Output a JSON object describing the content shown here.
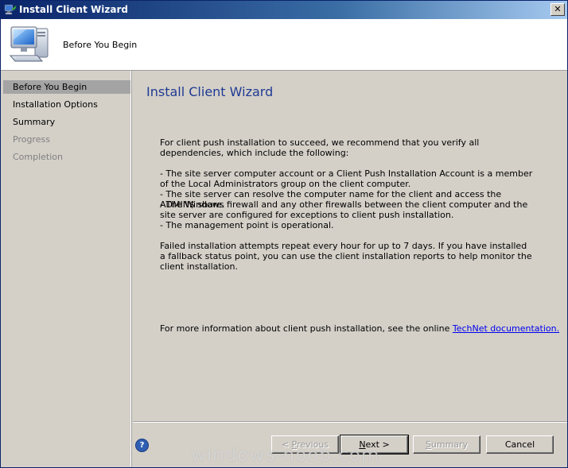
{
  "window": {
    "title": "Install Client Wizard",
    "close_glyph": "✕"
  },
  "header": {
    "title": "Before You Begin",
    "icon": "computer-icon"
  },
  "nav": {
    "items": [
      {
        "label": "Before You Begin",
        "state": "active"
      },
      {
        "label": "Installation Options",
        "state": "normal"
      },
      {
        "label": "Summary",
        "state": "normal"
      },
      {
        "label": "Progress",
        "state": "disabled"
      },
      {
        "label": "Completion",
        "state": "disabled"
      }
    ]
  },
  "content": {
    "heading": "Install Client Wizard",
    "paragraphs": [
      "For client push installation to succeed, we recommend that you verify all dependencies, which include the following:",
      "- The site server computer account or a Client Push Installation Account is a member of the Local Administrators group on the client computer.",
      "- The site server can resolve the computer name for the client and access the ADMIN$ share.",
      "- The Windows firewall and any other firewalls between the client computer and the site server are configured for exceptions to client push installation.",
      "- The management point is operational.",
      "Failed installation attempts repeat every hour for up to 7 days. If you have installed a fallback status point, you can use the client installation reports to help monitor the client installation."
    ],
    "more_info_prefix": "For more information about client push installation, see the online ",
    "more_info_link": "TechNet documentation."
  },
  "footer": {
    "help_glyph": "?",
    "previous_prefix": "< ",
    "previous_hotkey": "P",
    "previous_rest": "revious",
    "next_hotkey": "N",
    "next_rest": "ext >",
    "summary_hotkey": "S",
    "summary_rest": "ummary",
    "cancel_label": "Cancel"
  },
  "watermark": "windows-noob.com",
  "colors": {
    "title_bar": "#0a246a",
    "heading": "#1f3a93",
    "link": "#0000ee",
    "active_nav": "#a4a4a4"
  }
}
